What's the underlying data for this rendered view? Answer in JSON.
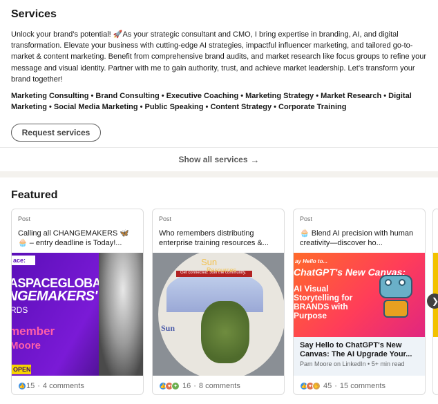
{
  "services": {
    "title": "Services",
    "description": "Unlock your brand’s potential! 🚀As your strategic consultant and CMO, I bring expertise in branding, AI, and digital transformation. Elevate your business with cutting-edge AI strategies, impactful influencer marketing, and tailored go-to-market & content marketing. Benefit from comprehensive brand audits, and market research like focus groups to refine your message and visual identity. Partner with me to gain authority, trust, and achieve market leadership. Let’s transform your brand together!",
    "tags": "Marketing Consulting • Brand Consulting • Executive Coaching • Marketing Strategy • Market Research • Digital Marketing • Social Media Marketing • Public Speaking • Content Strategy • Corporate Training",
    "request_label": "Request services",
    "show_all_label": "Show all services",
    "show_all_arrow": "→"
  },
  "featured": {
    "title": "Featured",
    "posts": [
      {
        "kind": "Post",
        "text": "Calling all CHANGEMAKERS 🦋 🧁 – entry deadline is Today!...",
        "image": {
          "brand": "ace:",
          "line1": "ASPACEGLOBAL",
          "line2": "NGEMAKERS'",
          "line3": "RDS",
          "line4": "member",
          "line5": "Moore",
          "badge": "OPEN"
        },
        "reactions": [
          "like"
        ],
        "count": "15",
        "comments": "4 comments"
      },
      {
        "kind": "Post",
        "text": "Who remembers distributing enterprise training resources &...",
        "image": {
          "brand_top": "Sun",
          "sub_top": "Resources",
          "banner": "Get connected. Join the community.",
          "logo": "Sun"
        },
        "reactions": [
          "like",
          "love",
          "celebrate"
        ],
        "count": "16",
        "comments": "8 comments"
      },
      {
        "kind": "Post",
        "text": "🧁 Blend AI precision with human creativity—discover ho...",
        "image": {
          "small": "ay Hello to...",
          "big": "ChatGPT's New Canvas:",
          "lines": "AI Visual Storytelling for BRANDS with Purpose"
        },
        "caption_title": "Say Hello to ChatGPT's New Canvas: The AI Upgrade Your...",
        "caption_meta": "Pam Moore on LinkedIn • 5+ min read",
        "reactions": [
          "like",
          "love",
          "support"
        ],
        "count": "45",
        "comments": "15 comments"
      }
    ],
    "next_label": "❯"
  },
  "colors": {
    "accent": "#0a66c2",
    "like": "#378fe9",
    "love": "#df704d",
    "celebrate": "#6dae4f"
  }
}
